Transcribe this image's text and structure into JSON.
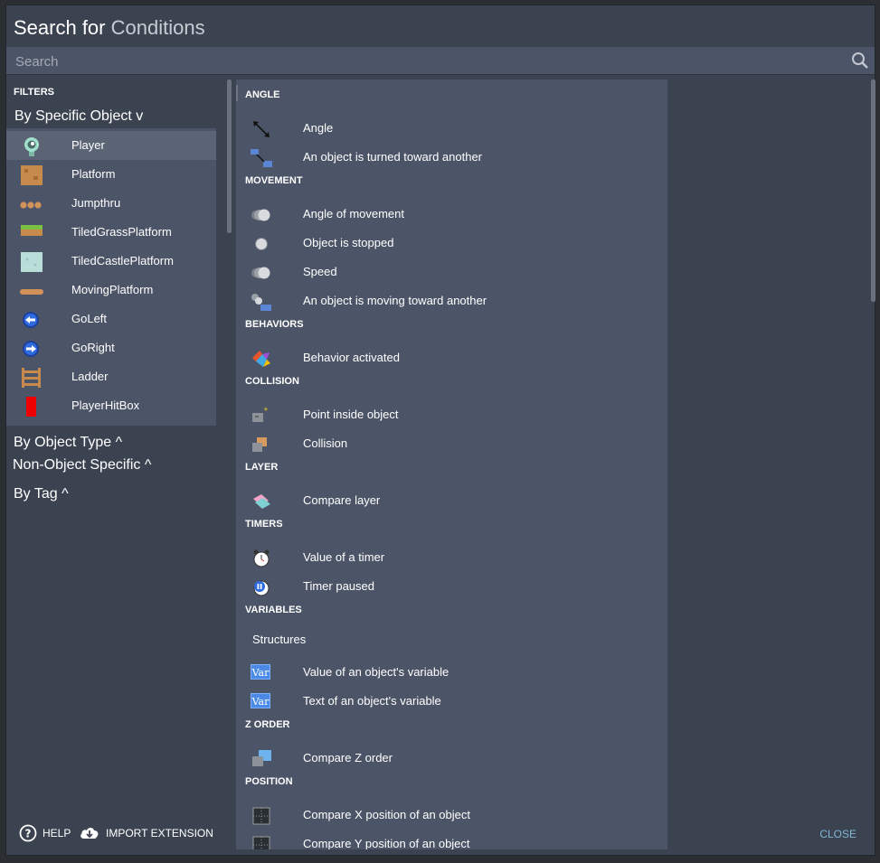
{
  "header": {
    "title_prefix": "Search for",
    "title_accent": "Conditions"
  },
  "search": {
    "placeholder": "Search",
    "value": ""
  },
  "sidebar": {
    "filters_label": "FILTERS",
    "by_specific_object": "By Specific Object v",
    "objects": [
      {
        "label": "Player",
        "icon": "player-icon",
        "selected": true
      },
      {
        "label": "Platform",
        "icon": "platform-icon"
      },
      {
        "label": "Jumpthru",
        "icon": "jumpthru-icon"
      },
      {
        "label": "TiledGrassPlatform",
        "icon": "grass-tile-icon"
      },
      {
        "label": "TiledCastlePlatform",
        "icon": "castle-tile-icon"
      },
      {
        "label": "MovingPlatform",
        "icon": "moving-platform-icon"
      },
      {
        "label": "GoLeft",
        "icon": "go-left-icon"
      },
      {
        "label": "GoRight",
        "icon": "go-right-icon"
      },
      {
        "label": "Ladder",
        "icon": "ladder-icon"
      },
      {
        "label": "PlayerHitBox",
        "icon": "hitbox-icon"
      }
    ],
    "by_object_type": "By Object Type ^",
    "non_object_specific": "Non-Object Specific ^",
    "by_tag": "By Tag ^"
  },
  "conditions": {
    "angle": {
      "category": "ANGLE",
      "items": [
        "Angle",
        "An object is turned toward another"
      ]
    },
    "movement": {
      "category": "MOVEMENT",
      "items": [
        "Angle of movement",
        "Object is stopped",
        "Speed",
        "An object is moving toward another"
      ]
    },
    "behaviors": {
      "category": "BEHAVIORS",
      "items": [
        "Behavior activated"
      ]
    },
    "collision": {
      "category": "COLLISION",
      "items": [
        "Point inside object",
        "Collision"
      ]
    },
    "layer": {
      "category": "LAYER",
      "items": [
        "Compare layer"
      ]
    },
    "timers": {
      "category": "TIMERS",
      "items": [
        "Value of a timer",
        "Timer paused"
      ]
    },
    "variables": {
      "category": "VARIABLES",
      "structures": "Structures",
      "var_icon_text": "Var",
      "items": [
        "Value of an object's variable",
        "Text of an object's variable"
      ]
    },
    "zorder": {
      "category": "Z ORDER",
      "items": [
        "Compare Z order"
      ]
    },
    "position": {
      "category": "POSITION",
      "items": [
        "Compare X position of an object",
        "Compare Y position of an object"
      ]
    }
  },
  "footer": {
    "help": "HELP",
    "import_extension": "IMPORT EXTENSION",
    "close": "CLOSE"
  },
  "colors": {
    "dialog_bg": "#3c4350",
    "panel_bg": "#4c5567",
    "selected_bg": "#5b6475",
    "close_link": "#7fb6d6"
  }
}
